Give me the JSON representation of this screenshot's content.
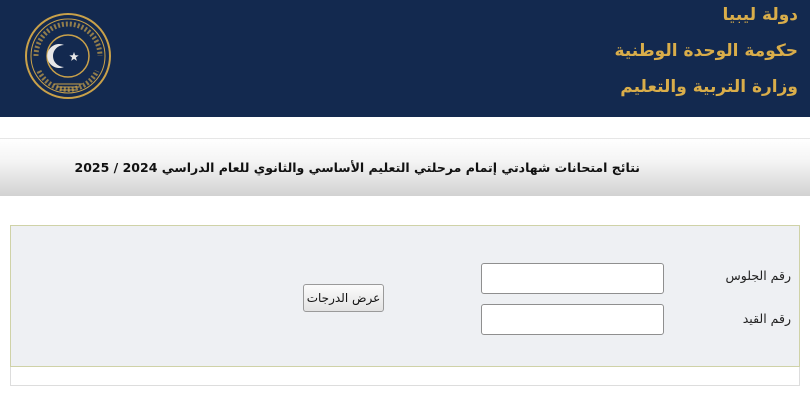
{
  "header": {
    "line1": "دولة ليبيا",
    "line2": "حكومة الوحدة الوطنية",
    "line3": "وزارة التربية والتعليم",
    "emblem_icon": "libya-ministry-seal-icon",
    "colors": {
      "background": "#13294f",
      "title_gold": "#d9ad4a"
    }
  },
  "title_bar": {
    "text": "نتائج امتحانات شهادتي إتمام مرحلتي التعليم الأساسي والثانوي للعام الدراسي 2024 / 2025"
  },
  "form": {
    "seat_label": "رقم الجلوس",
    "seat_value": "",
    "registration_label": "رقم القيد",
    "registration_value": "",
    "submit_label": "عرض الدرجات"
  }
}
